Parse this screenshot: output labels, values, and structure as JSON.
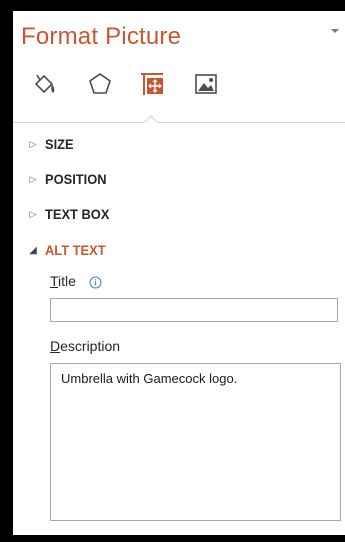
{
  "pane": {
    "title": "Format Picture",
    "accent_color": "#c9562f",
    "tabs": [
      {
        "name": "fill-line-icon"
      },
      {
        "name": "effects-icon"
      },
      {
        "name": "size-properties-icon",
        "selected": true
      },
      {
        "name": "picture-icon"
      }
    ]
  },
  "sections": [
    {
      "label": "SIZE",
      "expanded": false
    },
    {
      "label": "POSITION",
      "expanded": false
    },
    {
      "label": "TEXT BOX",
      "expanded": false
    },
    {
      "label": "ALT TEXT",
      "expanded": true
    }
  ],
  "alt_text": {
    "title_label_underlined": "T",
    "title_label_rest": "itle",
    "title_value": "",
    "description_label_underlined": "D",
    "description_label_rest": "escription",
    "description_value": "Umbrella with Gamecock logo."
  }
}
